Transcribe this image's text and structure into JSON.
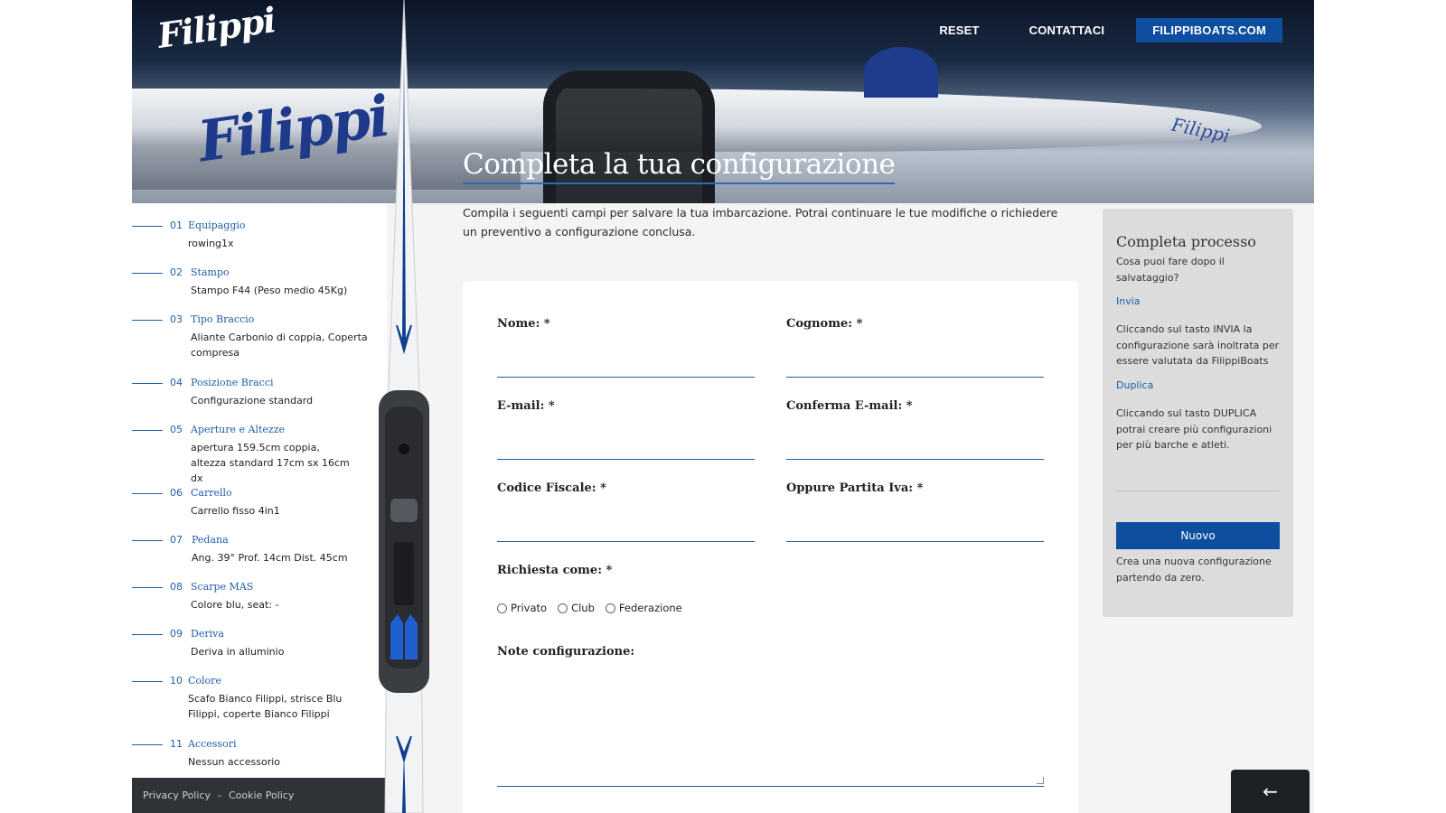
{
  "header": {
    "logo_text": "Filippi",
    "nav": {
      "reset": "RESET",
      "contact": "CONTATTACI",
      "site": "FILIPPIBOATS.COM"
    },
    "hero_logo_text": "Filippi"
  },
  "page": {
    "title": "Completa la tua configurazione",
    "intro": "Compila i seguenti campi per salvare la tua imbarcazione. Potrai continuare le tue modifiche o richiedere un preventivo a configurazione conclusa."
  },
  "steps": [
    {
      "num": "01",
      "title": "Equipaggio",
      "value": "rowing1x"
    },
    {
      "num": "02",
      "title": "Stampo",
      "value": "Stampo F44 (Peso medio 45Kg)"
    },
    {
      "num": "03",
      "title": "Tipo Braccio",
      "value": "Aliante Carbonio di coppia, Coperta compresa"
    },
    {
      "num": "04",
      "title": "Posizione Bracci",
      "value": "Configurazione standard"
    },
    {
      "num": "05",
      "title": "Aperture e Altezze",
      "value": "apertura 159.5cm coppia, altezza standard 17cm sx 16cm dx"
    },
    {
      "num": "06",
      "title": "Carrello",
      "value": "Carrello fisso 4in1"
    },
    {
      "num": "07",
      "title": "Pedana",
      "value": "Ang. 39° Prof. 14cm Dist. 45cm"
    },
    {
      "num": "08",
      "title": "Scarpe MAS",
      "value": "Colore blu, seat: -"
    },
    {
      "num": "09",
      "title": "Deriva",
      "value": "Deriva in alluminio"
    },
    {
      "num": "10",
      "title": "Colore",
      "value": "Scafo Bianco Filippi, strisce Blu Filippi, coperte Bianco Filippi"
    },
    {
      "num": "11",
      "title": "Accessori",
      "value": "Nessun accessorio"
    }
  ],
  "footer": {
    "privacy": "Privacy Policy",
    "separator": "-",
    "cookie": "Cookie Policy"
  },
  "form": {
    "nome": "Nome: *",
    "cognome": "Cognome: *",
    "email": "E-mail: *",
    "conferma_email": "Conferma E-mail: *",
    "codice_fiscale": "Codice Fiscale: *",
    "partita_iva": "Oppure Partita Iva: *",
    "richiesta": "Richiesta come: *",
    "options": [
      "Privato",
      "Club",
      "Federazione"
    ],
    "note": "Note configurazione:"
  },
  "panel": {
    "title": "Completa processo",
    "question": "Cosa puoi fare dopo il salvataggio?",
    "invia_link": "Invia",
    "invia_text": "Cliccando sul tasto INVIA la configurazione sarà inoltrata per essere valutata da FilippiBoats",
    "duplica_link": "Duplica",
    "duplica_text": "Cliccando sul tasto DUPLICA potrai creare più configurazioni per più barche e atleti.",
    "nuovo_button": "Nuovo",
    "nuovo_text": "Crea una nuova configurazione partendo da zero."
  },
  "icons": {
    "back": "arrow-left-icon"
  },
  "colors": {
    "accent": "#0d4e9e",
    "link": "#1d5ea8",
    "panel_bg": "#dcdcdc",
    "dark": "#1e2124"
  }
}
